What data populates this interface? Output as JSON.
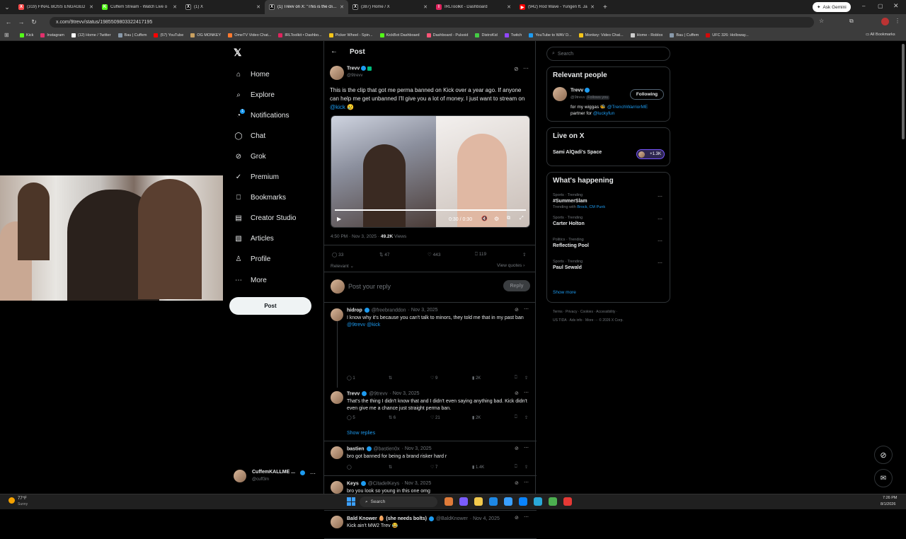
{
  "browser": {
    "tabs": [
      {
        "title": "(319) FINAL BOSS ENGAGED",
        "color": "#ff4a4a",
        "letter": "X"
      },
      {
        "title": "Cuffem Stream - Watch Live o",
        "color": "#53fc18",
        "letter": "K"
      },
      {
        "title": "(1) X",
        "color": "#000000",
        "letter": "X"
      },
      {
        "title": "(1) Trevv on X: \"This is the clip t",
        "color": "#000000",
        "letter": "X"
      },
      {
        "title": "(387) Home / X",
        "color": "#000000",
        "letter": "X"
      },
      {
        "title": "IRLToolkit - Dashboard",
        "color": "#e0245e",
        "letter": "I"
      },
      {
        "title": "(942) Rod Wave - Yungen ft. Ja",
        "color": "#ff0000",
        "letter": "▶"
      }
    ],
    "new_tab": "+",
    "ask_gemini": "Ask Gemini",
    "url": "x.com/9trevv/status/1985509803322417195",
    "bookmarks": [
      {
        "label": "Kick",
        "color": "#53fc18"
      },
      {
        "label": "Instagram",
        "color": "#e1306c"
      },
      {
        "label": "(12) Home / Twitter",
        "color": "#ffffff"
      },
      {
        "label": "Bau | Cuffem",
        "color": "#8899aa"
      },
      {
        "label": "(57) YouTube",
        "color": "#ff0000"
      },
      {
        "label": "OG MONKEY",
        "color": "#c8a060"
      },
      {
        "label": "OmeTV Video Chat...",
        "color": "#ff7a2f"
      },
      {
        "label": "IRLToolkit • Dashbo...",
        "color": "#e0245e"
      },
      {
        "label": "Picker Wheel - Spin...",
        "color": "#f5c518"
      },
      {
        "label": "KickBot Dashboard",
        "color": "#53fc18"
      },
      {
        "label": "Dashboard - Pulsoid",
        "color": "#ff5577"
      },
      {
        "label": "DistroKid",
        "color": "#44cc44"
      },
      {
        "label": "Twitch",
        "color": "#9146ff"
      },
      {
        "label": "YouTube to WAV D...",
        "color": "#1d9bf0"
      },
      {
        "label": "Monkey: Video Chat...",
        "color": "#f5c518"
      },
      {
        "label": "Home - Roblox",
        "color": "#cccccc"
      },
      {
        "label": "Bau | Cuffem",
        "color": "#8899aa"
      },
      {
        "label": "UFC 326: Holloway...",
        "color": "#d20a0a"
      }
    ],
    "all_bookmarks": "All Bookmarks"
  },
  "nav": {
    "items": [
      {
        "label": "Home",
        "icon": "home-icon",
        "glyph": "⌂"
      },
      {
        "label": "Explore",
        "icon": "search-icon",
        "glyph": "⌕"
      },
      {
        "label": "Notifications",
        "icon": "bell-icon",
        "glyph": "◔"
      },
      {
        "label": "Chat",
        "icon": "chat-icon",
        "glyph": "◯"
      },
      {
        "label": "Grok",
        "icon": "grok-icon",
        "glyph": "⊘"
      },
      {
        "label": "Premium",
        "icon": "premium-icon",
        "glyph": "✓"
      },
      {
        "label": "Bookmarks",
        "icon": "bookmark-icon",
        "glyph": "⎕"
      },
      {
        "label": "Creator Studio",
        "icon": "studio-icon",
        "glyph": "▤"
      },
      {
        "label": "Articles",
        "icon": "articles-icon",
        "glyph": "▧"
      },
      {
        "label": "Profile",
        "icon": "profile-icon",
        "glyph": "♙"
      },
      {
        "label": "More",
        "icon": "more-icon",
        "glyph": "⋯"
      }
    ],
    "notification_badge": "1",
    "post_button": "Post",
    "account": {
      "name": "CuffemKALLME ...",
      "handle": "@cuff3m"
    }
  },
  "post": {
    "header": "Post",
    "author": "Trevv",
    "handle": "@9trevv",
    "text": "This is the clip that got me perma banned on Kick over a year ago. If anyone can help me get unbanned I'll give you a lot of money. I just want to stream on",
    "mention": "@kick",
    "emoji": "😢",
    "video_time": "0:30 / 0:30",
    "video_progress": 1.0,
    "timestamp": "4:50 PM · Nov 3, 2025 ·",
    "views_count": "49.2K",
    "views_label": "Views",
    "replies": "33",
    "reposts": "47",
    "likes": "443",
    "bookmarks": "119",
    "sort": "Relevant",
    "view_quotes": "View quotes",
    "reply_placeholder": "Post your reply",
    "reply_button": "Reply"
  },
  "replies": [
    {
      "name": "hidrop",
      "handle": "@freebranddon",
      "date": "· Nov 3, 2025",
      "text": "I know why it's because you can't talk to minors, they told me that in my past ban",
      "mentions": "@9trevv @kick",
      "replies": "1",
      "reposts": "",
      "likes": "9",
      "views": "2K"
    },
    {
      "name": "Trevv",
      "handle": "@9trevv",
      "date": "· Nov 3, 2025",
      "text": "That's the thing I didn't know that and I didn't even saying anything bad. Kick didn't even give me a chance just straight perma ban.",
      "mentions": "",
      "replies": "5",
      "reposts": "6",
      "likes": "21",
      "views": "2K",
      "show_replies": "Show replies"
    },
    {
      "name": "bastien",
      "handle": "@bastien0x",
      "date": "· Nov 3, 2025",
      "text": "bro got banned for being a brand risker hard r",
      "mentions": "",
      "replies": "",
      "reposts": "",
      "likes": "7",
      "views": "1.4K"
    },
    {
      "name": "Keys",
      "handle": "@CitadelKeys",
      "date": "· Nov 3, 2025",
      "text": "bro you look so young in this one omg",
      "mentions": "",
      "replies": "",
      "reposts": "",
      "likes": "3",
      "views": "848"
    },
    {
      "name": "Bald Knower 🥚 (she needs bolts)",
      "handle": "@BaldKnower",
      "date": "· Nov 4, 2025",
      "text": "Kick ain't MW2 Trev 😂",
      "mentions": "",
      "replies": "",
      "reposts": "",
      "likes": "",
      "views": ""
    }
  ],
  "sidebar": {
    "search_placeholder": "Search",
    "relevant_title": "Relevant people",
    "person": {
      "name": "Trevv",
      "handle": "@9trevv",
      "follows_you": "Follows you",
      "button": "Following",
      "bio_prefix": "for my wiggas 🐝",
      "bio_mention1": "@TrenchWarriorME",
      "bio_mid": "partner for",
      "bio_mention2": "@luckyfun"
    },
    "live_title": "Live on X",
    "live_space": "Sami AlQadi's Space",
    "live_count": "+1.3K",
    "happening_title": "What's happening",
    "trends": [
      {
        "cat": "Sports · Trending",
        "title": "#SummerSlam",
        "sub": "Trending with",
        "sub_links": "Brock, CM Punk"
      },
      {
        "cat": "Sports · Trending",
        "title": "Carter Holton",
        "sub": "",
        "sub_links": ""
      },
      {
        "cat": "Politics · Trending",
        "title": "Reflecting Pool",
        "sub": "",
        "sub_links": ""
      },
      {
        "cat": "Sports · Trending",
        "title": "Paul Sewald",
        "sub": "",
        "sub_links": ""
      }
    ],
    "show_more": "Show more",
    "footer1": "Terms · Privacy · Cookies · Accessibility ·",
    "footer2": "US TIDA · Ads info · More ··· © 2026 X Corp."
  },
  "taskbar": {
    "weather_temp": "77°F",
    "weather_desc": "Sunny",
    "search": "Search",
    "time": "7:26 PM",
    "date": "8/1/2026"
  },
  "colors": {
    "accent": "#1d9bf0",
    "bg": "#000000",
    "border": "#2f3336",
    "muted": "#71767b"
  }
}
